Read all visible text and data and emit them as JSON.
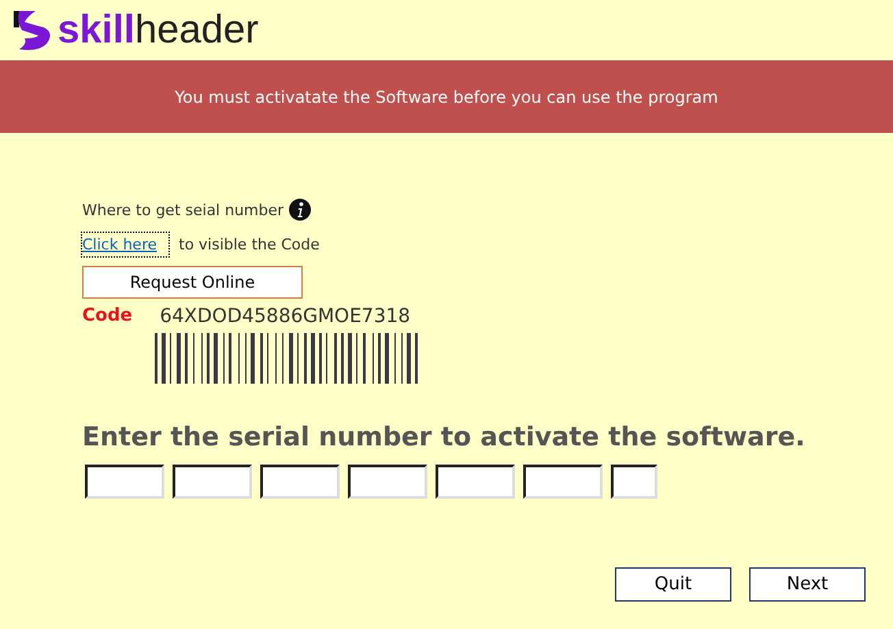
{
  "logo": {
    "brand_bold": "skill",
    "brand_light": "header"
  },
  "banner": {
    "message": "You must activatate the Software before you can use the program"
  },
  "serial_help": {
    "label": "Where to get seial number",
    "link": "Click here",
    "link_suffix": "to visible the Code"
  },
  "request_button": "Request Online",
  "code": {
    "label": "Code",
    "value": "64XDOD45886GMOE7318"
  },
  "heading": "Enter the serial number to activate the software.",
  "serial_fields": [
    {
      "kind": "wide"
    },
    {
      "kind": "wide"
    },
    {
      "kind": "wide"
    },
    {
      "kind": "wide"
    },
    {
      "kind": "wide"
    },
    {
      "kind": "wide"
    },
    {
      "kind": "narrow"
    }
  ],
  "buttons": [
    "Quit",
    "Next"
  ]
}
